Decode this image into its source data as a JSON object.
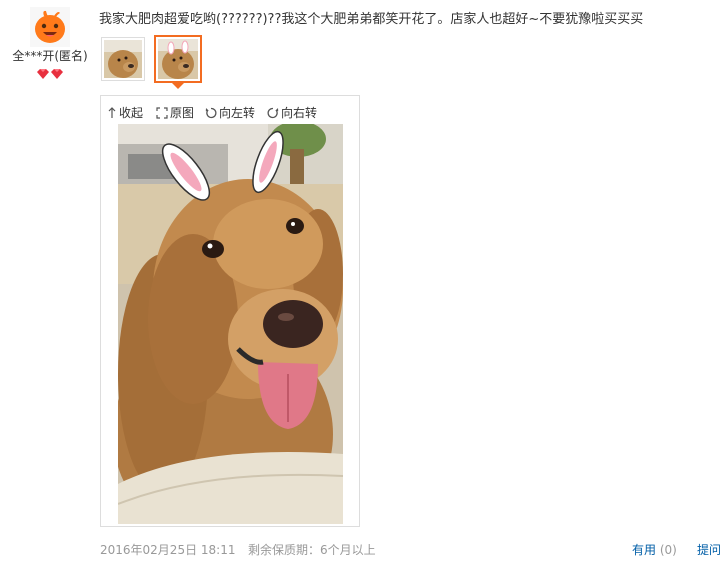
{
  "review": {
    "reviewer_name": "全***开(匿名)",
    "text": "我家大肥肉超爱吃哟(??????)??我这个大肥弟弟都笑开花了。店家人也超好~不要犹豫啦买买买",
    "date": "2016年02月25日 18:11",
    "shelf_life": "剩余保质期：6个月以上",
    "useful_label": "有用",
    "useful_count": "(0)",
    "ask_label": "提问"
  },
  "viewer": {
    "tools": {
      "collapse": "收起",
      "original": "原图",
      "rotate_left": "向左转",
      "rotate_right": "向右转"
    }
  },
  "icons": {
    "avatar": "orange-mascot-avatar-icon",
    "badges": "red-diamond-badge-icon",
    "collapse": "arrow-up-icon",
    "original": "expand-icon",
    "rotate_left": "rotate-left-icon",
    "rotate_right": "rotate-right-icon"
  },
  "colors": {
    "accent": "#f36c21",
    "link": "#005ea7",
    "muted": "#999999",
    "text": "#333333"
  }
}
